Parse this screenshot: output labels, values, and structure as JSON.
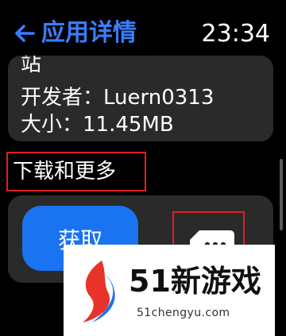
{
  "header": {
    "back_icon": "arrow-left-icon",
    "title": "应用详情",
    "time": "23:34"
  },
  "info": {
    "lines": [
      "站",
      "开发者：Luern0313",
      "大小：11.45MB"
    ]
  },
  "section": {
    "title": "下载和更多"
  },
  "actions": {
    "get_label": "获取",
    "more_icon": "more-dots-icon"
  },
  "watermark": {
    "title": "51新游戏",
    "url": "51chengyu.com"
  },
  "colors": {
    "accent": "#3a7dff",
    "button": "#1a73f0",
    "card": "#2a2a2a",
    "highlight": "#e01f1f"
  }
}
